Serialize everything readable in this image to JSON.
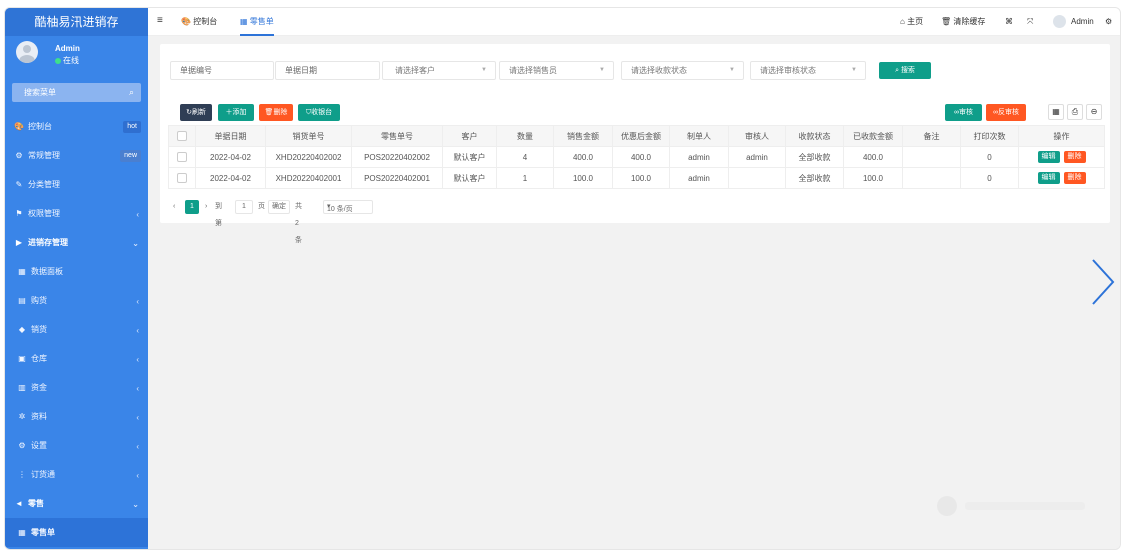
{
  "app": {
    "title": "酷柚易汛进销存"
  },
  "user": {
    "name": "Admin",
    "status": "在线"
  },
  "sidebar": {
    "search_label": "搜索菜单",
    "items": [
      {
        "icon": "🎨",
        "label": "控制台",
        "badge": "hot"
      },
      {
        "icon": "⚙",
        "label": "常规管理",
        "badge": "new"
      },
      {
        "icon": "✎",
        "label": "分类管理"
      },
      {
        "icon": "⚑",
        "label": "权限管理",
        "arrow": "‹"
      },
      {
        "icon": "▶",
        "label": "进销存管理",
        "arrow": "⌄"
      },
      {
        "icon": "▦",
        "label": "数据面板"
      },
      {
        "icon": "▤",
        "label": "购货",
        "arrow": "‹"
      },
      {
        "icon": "◆",
        "label": "销货",
        "arrow": "‹"
      },
      {
        "icon": "▣",
        "label": "仓库",
        "arrow": "‹"
      },
      {
        "icon": "▥",
        "label": "资金",
        "arrow": "‹"
      },
      {
        "icon": "✲",
        "label": "资料",
        "arrow": "‹"
      },
      {
        "icon": "⚙",
        "label": "设置",
        "arrow": "‹"
      },
      {
        "icon": "⋮",
        "label": "订货通",
        "arrow": "‹"
      },
      {
        "icon": "◄",
        "label": "零售",
        "arrow": "⌄"
      },
      {
        "icon": "▦",
        "label": "零售单"
      }
    ]
  },
  "header": {
    "tab_console": "控制台",
    "tab_retail": "零售单",
    "home": "主页",
    "clear_cache": "清除缓存",
    "user": "Admin"
  },
  "filters": {
    "order_no": "单据编号",
    "order_date": "单据日期",
    "customer": "请选择客户",
    "salesperson": "请选择销售员",
    "collect_status": "请选择收款状态",
    "audit_status": "请选择审核状态",
    "search_btn": "搜索"
  },
  "toolbar": {
    "refresh": "刷新",
    "add": "添加",
    "delete": "删除",
    "collect": "收银台",
    "audit": "审核",
    "unaudit": "反审核"
  },
  "table": {
    "columns": [
      "单据日期",
      "销货单号",
      "零售单号",
      "客户",
      "数量",
      "销售金额",
      "优惠后金额",
      "制单人",
      "审核人",
      "收款状态",
      "已收款金额",
      "备注",
      "打印次数",
      "操作"
    ],
    "rows": [
      [
        "2022-04-02",
        "XHD20220402002",
        "POS20220402002",
        "默认客户",
        "4",
        "400.0",
        "400.0",
        "admin",
        "admin",
        "全部收款",
        "400.0",
        "",
        "0"
      ],
      [
        "2022-04-02",
        "XHD20220402001",
        "POS20220402001",
        "默认客户",
        "1",
        "100.0",
        "100.0",
        "admin",
        "",
        "全部收款",
        "100.0",
        "",
        "0"
      ]
    ],
    "edit": "编辑",
    "del": "删除"
  },
  "pager": {
    "current": "1",
    "goto": "到第",
    "page_input": "1",
    "page_unit": "页",
    "confirm": "确定",
    "total": "共 2 条",
    "per_page": "10 条/页"
  }
}
